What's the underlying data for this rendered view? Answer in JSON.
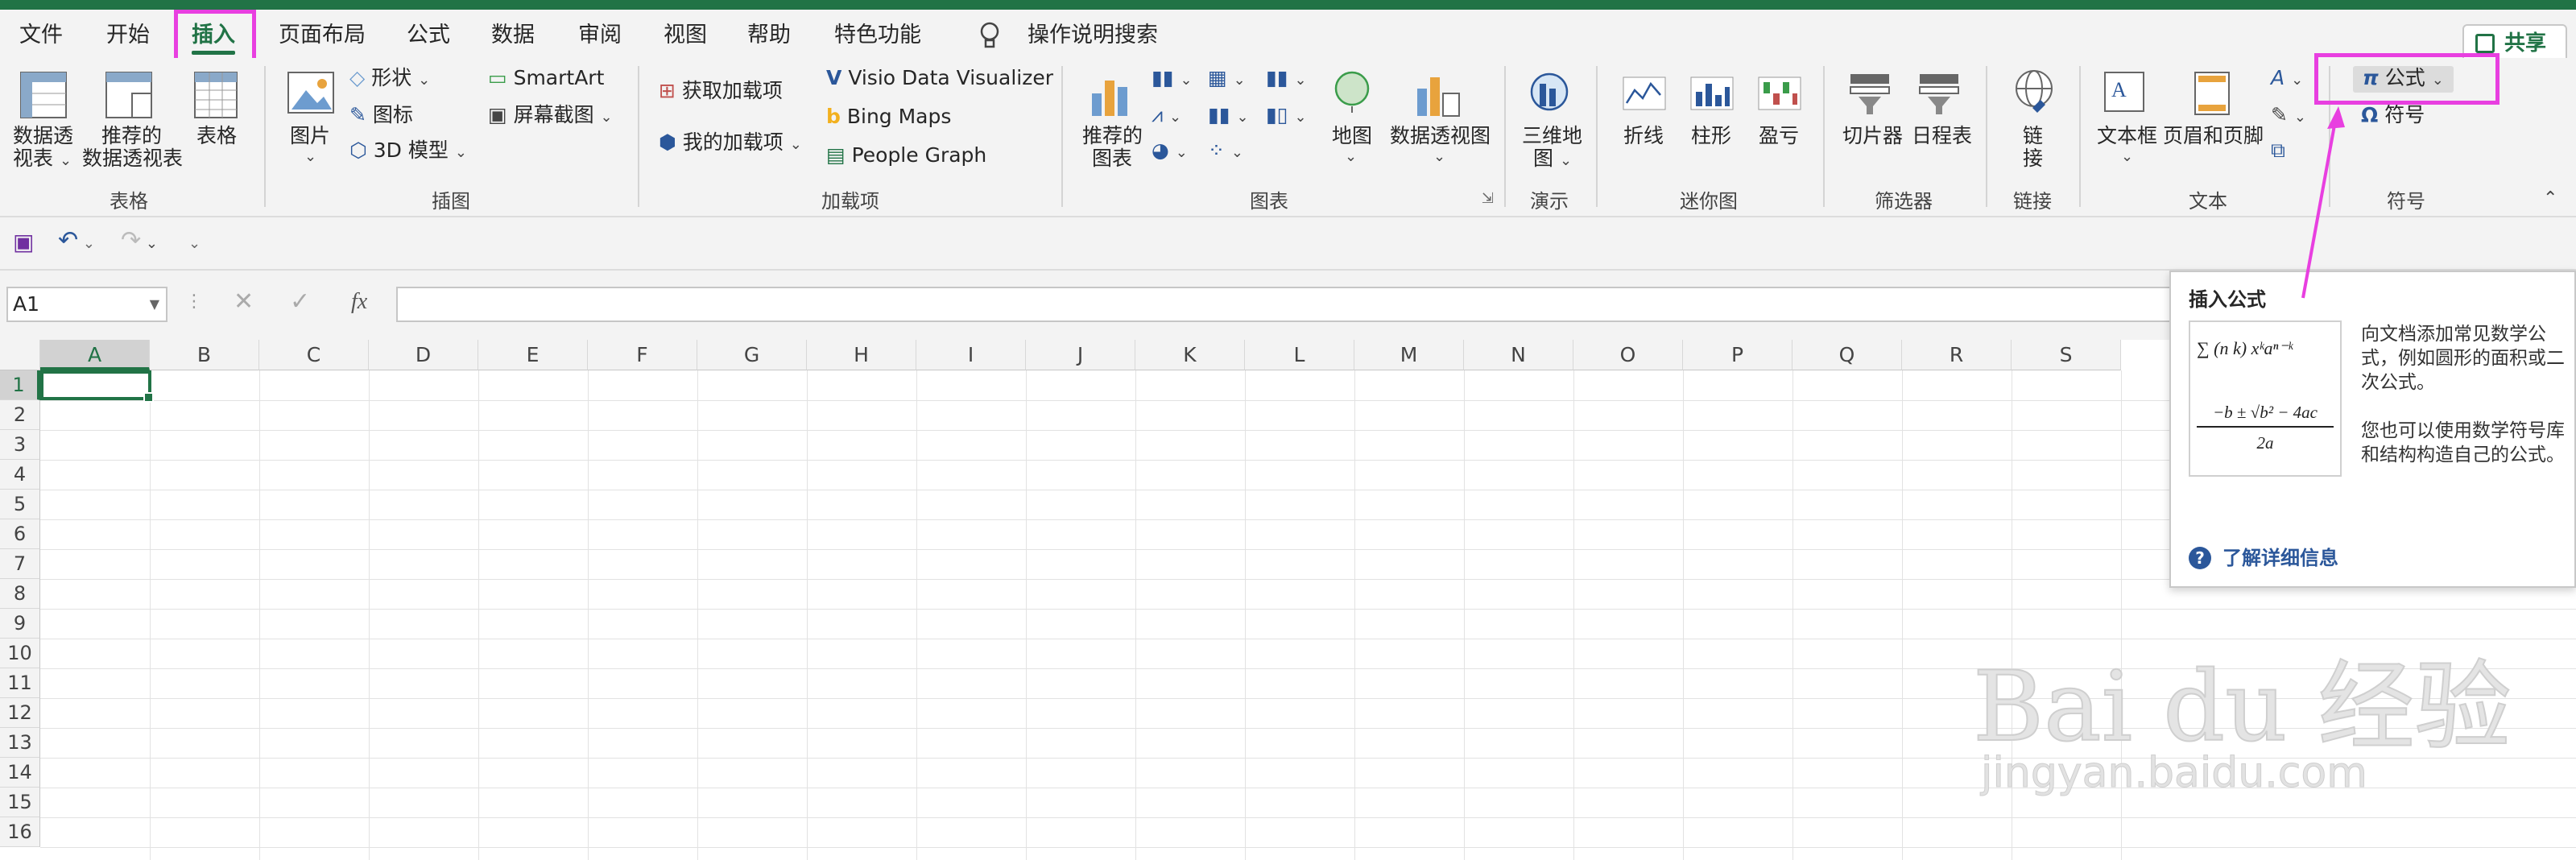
{
  "colors": {
    "accent": "#217346",
    "highlight": "#e83fe0",
    "link": "#2b579a"
  },
  "menu": {
    "tabs": [
      "文件",
      "开始",
      "插入",
      "页面布局",
      "公式",
      "数据",
      "审阅",
      "视图",
      "帮助",
      "特色功能"
    ],
    "active_tab": "插入",
    "search_label": "操作说明搜索",
    "share_label": "共享"
  },
  "ribbon": {
    "tables": {
      "pivot": "数据透\n视表",
      "pivot_a": "数据透",
      "pivot_b": "视表",
      "recommended_a": "推荐的",
      "recommended_b": "数据透视表",
      "table": "表格",
      "group": "表格"
    },
    "illustrations": {
      "picture": "图片",
      "shapes": "形状",
      "icons": "图标",
      "model3d": "3D 模型",
      "smartart": "SmartArt",
      "screenshot": "屏幕截图",
      "group": "插图"
    },
    "addins": {
      "get": "获取加载项",
      "my": "我的加载项",
      "visio": "Visio Data Visualizer",
      "bing": "Bing Maps",
      "people": "People Graph",
      "group": "加载项"
    },
    "charts": {
      "recommended_a": "推荐的",
      "recommended_b": "图表",
      "map": "地图",
      "pivotchart": "数据透视图",
      "group": "图表"
    },
    "tours": {
      "map3d_a": "三维地",
      "map3d_b": "图",
      "group": "演示"
    },
    "sparklines": {
      "line": "折线",
      "column": "柱形",
      "winloss": "盈亏",
      "group": "迷你图"
    },
    "filters": {
      "slicer": "切片器",
      "timeline": "日程表",
      "group": "筛选器"
    },
    "links": {
      "link_a": "链",
      "link_b": "接",
      "group": "链接"
    },
    "text": {
      "textbox": "文本框",
      "headerfooter": "页眉和页脚",
      "group": "文本"
    },
    "symbols": {
      "equation": "公式",
      "symbol": "符号",
      "group": "符号"
    }
  },
  "formula_bar": {
    "name_box": "A1",
    "fx": "fx"
  },
  "grid": {
    "columns": [
      "A",
      "B",
      "C",
      "D",
      "E",
      "F",
      "G",
      "H",
      "I",
      "J",
      "K",
      "L",
      "M",
      "N",
      "O",
      "P",
      "Q",
      "R",
      "S"
    ],
    "rows": [
      "1",
      "2",
      "3",
      "4",
      "5",
      "6",
      "7",
      "8",
      "9",
      "10",
      "11",
      "12",
      "13",
      "14",
      "15",
      "16"
    ],
    "active_cell": "A1"
  },
  "tooltip": {
    "title": "插入公式",
    "desc1": "向文档添加常见数学公式，例如圆形的面积或二次公式。",
    "desc2": "您也可以使用数学符号库和结构构造自己的公式。",
    "link": "了解详细信息",
    "formula1": "∑ (n k) xᵏaⁿ⁻ᵏ",
    "formula2_num": "−b ± √b² − 4ac",
    "formula2_den": "2a"
  },
  "watermark": {
    "main": "Bai du 经验",
    "sub": "jingyan.baidu.com"
  }
}
